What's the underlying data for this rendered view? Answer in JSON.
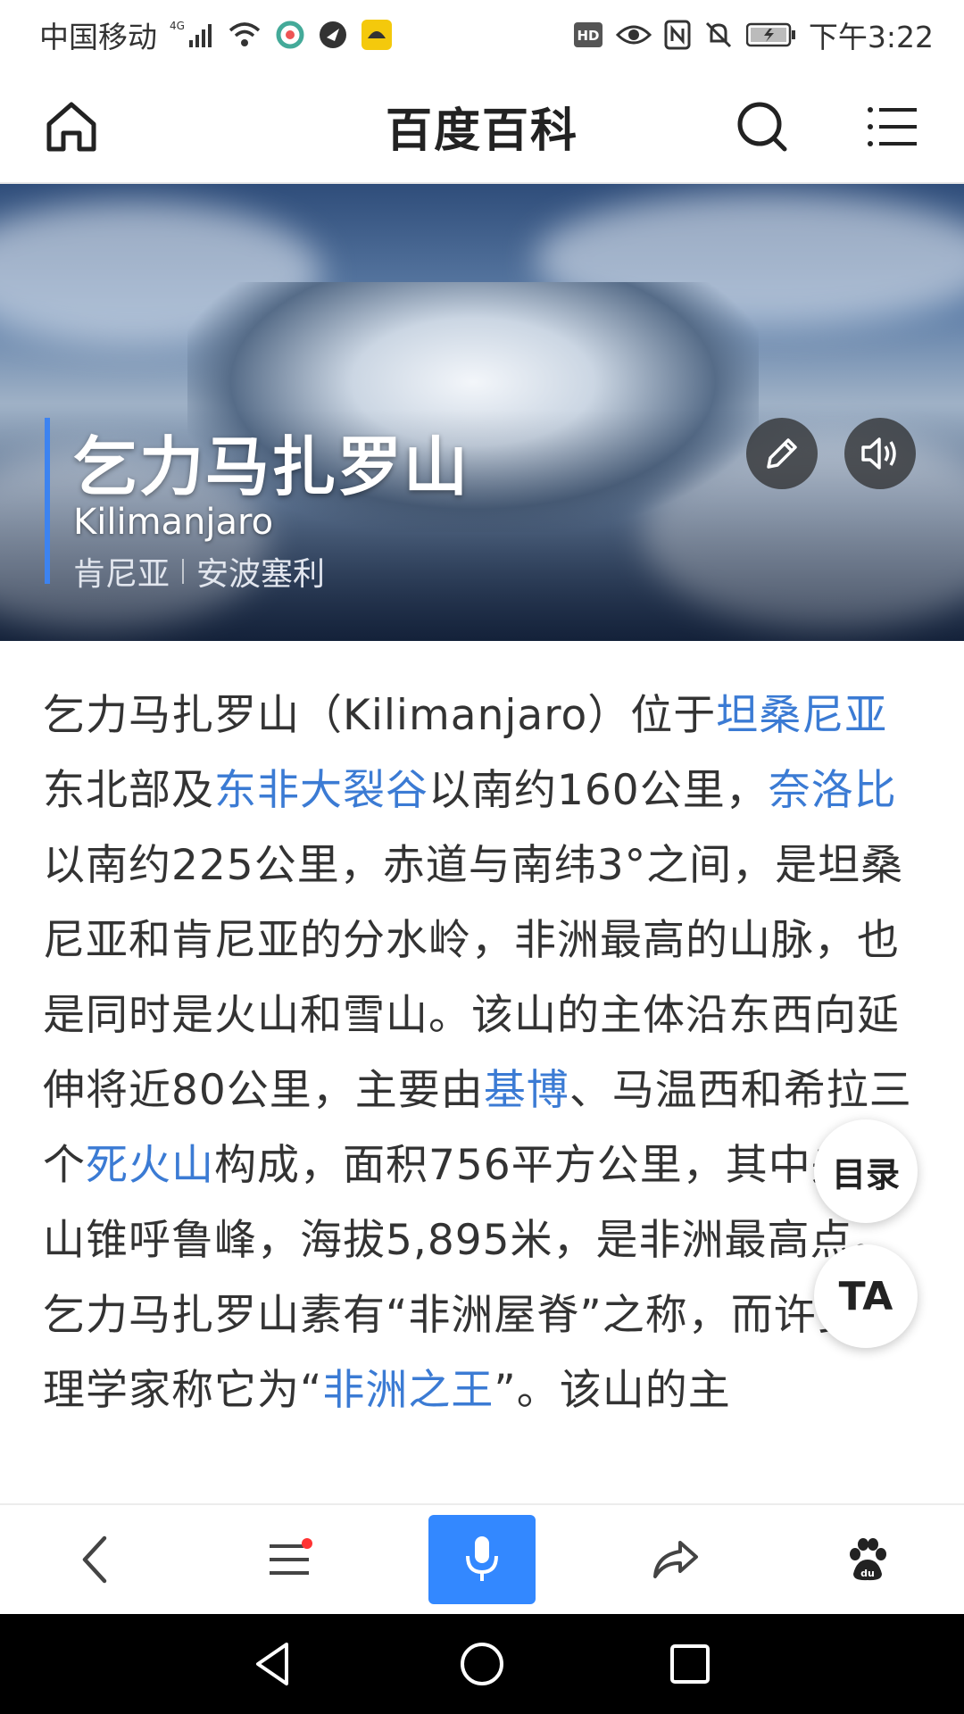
{
  "status_bar": {
    "carrier": "中国移动",
    "network": "4G",
    "time": "下午3:22",
    "hd": "HD"
  },
  "app_bar": {
    "title": "百度百科"
  },
  "hero": {
    "title": "乞力马扎罗山",
    "subtitle": "Kilimanjaro",
    "tags": [
      "肯尼亚",
      "安波塞利"
    ]
  },
  "article": {
    "segments": [
      {
        "text": "乞力马扎罗山（Kilimanjaro）位于",
        "link": false
      },
      {
        "text": "坦桑尼亚",
        "link": true
      },
      {
        "text": "东北部及",
        "link": false
      },
      {
        "text": "东非大裂谷",
        "link": true
      },
      {
        "text": "以南约160公里，",
        "link": false
      },
      {
        "text": "奈洛比",
        "link": true
      },
      {
        "text": "以南约225公里，赤道与南纬3°之间，是坦桑尼亚和肯尼亚的分水岭，非洲最高的山脉，也是同时是火山和雪山。该山的主体沿东西向延伸将近80公里，主要由",
        "link": false
      },
      {
        "text": "基博",
        "link": true
      },
      {
        "text": "、马温西和希拉三个",
        "link": false
      },
      {
        "text": "死火山",
        "link": true
      },
      {
        "text": "构成，面积756平方公里，其中央火山锥呼鲁峰，海拔5,895米，是非洲最高点。乞力马扎罗山素有“非洲屋脊”之称，而许多地理学家称它为“",
        "link": false
      },
      {
        "text": "非洲之王",
        "link": true
      },
      {
        "text": "”。该山的主",
        "link": false
      }
    ]
  },
  "floating": {
    "toc_label": "目录",
    "font_label": "TA"
  },
  "colors": {
    "link": "#3b7bd4",
    "accent": "#3388ff"
  }
}
